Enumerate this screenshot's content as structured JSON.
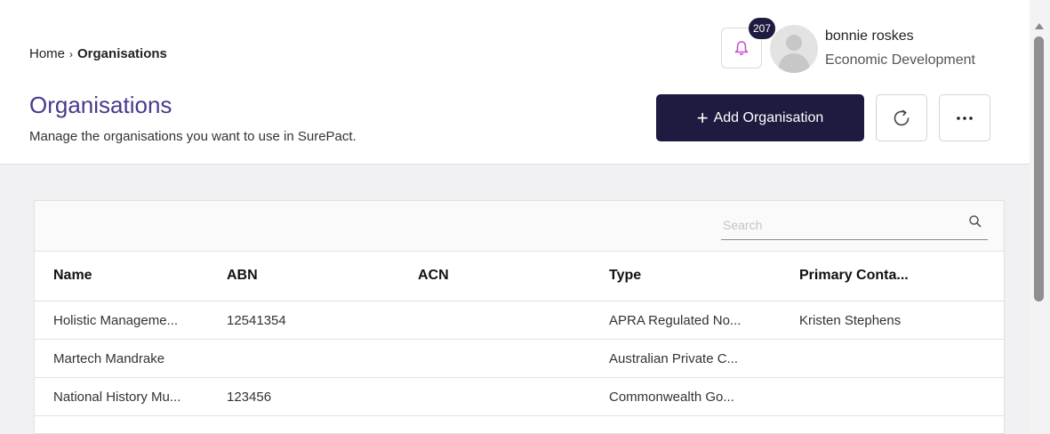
{
  "breadcrumb": {
    "home": "Home",
    "separator": "›",
    "current": "Organisations"
  },
  "page": {
    "title": "Organisations",
    "subtitle": "Manage the organisations you want to use in SurePact."
  },
  "notifications": {
    "count": "207",
    "icon": "bell-icon"
  },
  "user": {
    "name": "bonnie roskes",
    "organisation": "Economic Development"
  },
  "actions": {
    "add_label": "Add Organisation",
    "add_icon": "plus-icon",
    "refresh_icon": "refresh-icon",
    "more_icon": "more-horizontal-icon"
  },
  "search": {
    "placeholder": "Search"
  },
  "table": {
    "columns": [
      "Name",
      "ABN",
      "ACN",
      "Type",
      "Primary Conta..."
    ],
    "rows": [
      [
        "Holistic Manageme...",
        "12541354",
        "",
        "APRA Regulated No...",
        "Kristen Stephens"
      ],
      [
        "Martech Mandrake",
        "",
        "",
        "Australian Private C...",
        ""
      ],
      [
        "National History Mu...",
        "123456",
        "",
        "Commonwealth Go...",
        ""
      ]
    ]
  },
  "colors": {
    "primary": "#1d1b3f",
    "title": "#4a3a8c",
    "bell": "#c94fd6",
    "content_bg": "#f1f1f4"
  }
}
